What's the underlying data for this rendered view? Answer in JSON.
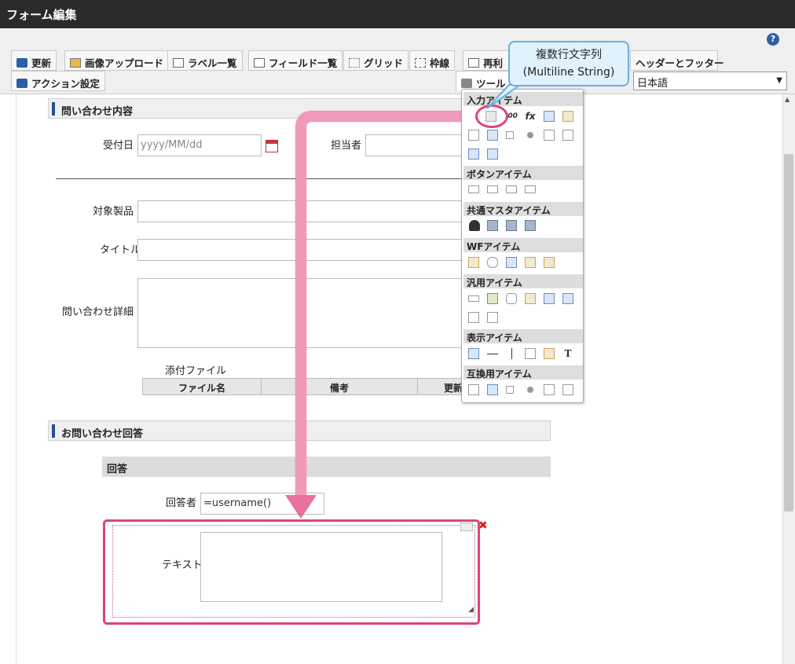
{
  "window": {
    "title": "フォーム編集",
    "help": "?"
  },
  "toolbar": {
    "tabs": [
      "更新",
      "画像アップロード",
      "ラベル一覧",
      "フィールド一覧",
      "グリッド",
      "枠線",
      "再利",
      "ヘッダーとフッター"
    ],
    "action_tab": "アクション設定",
    "tools_tab": "ツール",
    "language": "日本語"
  },
  "tooltip": {
    "line1": "複数行文字列",
    "line2": "(Multiline String)"
  },
  "palette": {
    "sections": [
      "入力アイテム",
      "ボタンアイテム",
      "共通マスタアイテム",
      "WFアイテム",
      "汎用アイテム",
      "表示アイテム",
      "互換用アイテム"
    ],
    "fx": "fx"
  },
  "form": {
    "section1_title": "問い合わせ内容",
    "received_label": "受付日",
    "received_placeholder": "yyyy/MM/dd",
    "assignee_label": "担当者",
    "product_label": "対象製品",
    "title_label": "タイトル",
    "detail_label": "問い合わせ詳細",
    "attachment_label": "添付ファイル",
    "grid_cols": [
      "ファイル名",
      "備考",
      "更新"
    ],
    "section2_title": "お問い合わせ回答",
    "answer_sub": "回答",
    "responder_label": "回答者",
    "responder_value": "=username()",
    "text_label": "テキスト"
  },
  "colors": {
    "accent_pink": "#e0417e",
    "tooltip_bg": "#e0f2fc",
    "section_bar": "#2a4f8f"
  }
}
